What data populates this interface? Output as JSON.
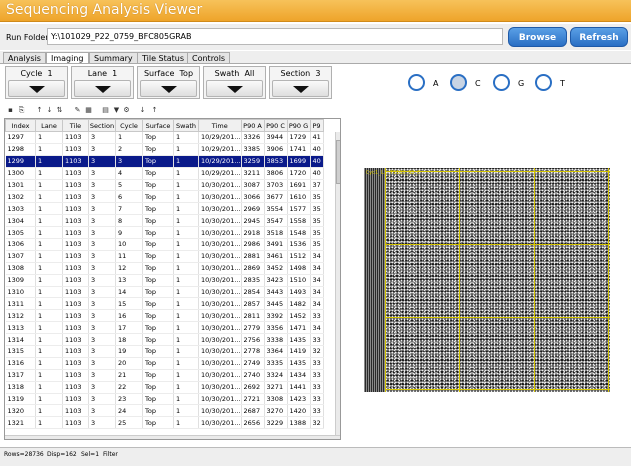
{
  "app": {
    "title": "Sequencing Analysis Viewer"
  },
  "run_folder": {
    "label": "Run Folder:",
    "value": "Y:\\101029_P22_0759_BFC805GRAB"
  },
  "buttons": {
    "browse": "Browse",
    "refresh": "Refresh"
  },
  "tabs": [
    {
      "label": "Analysis"
    },
    {
      "label": "Imaging"
    },
    {
      "label": "Summary"
    },
    {
      "label": "Tile Status"
    },
    {
      "label": "Controls"
    }
  ],
  "active_tab": "Imaging",
  "filters": [
    {
      "label": "Cycle",
      "value": "1"
    },
    {
      "label": "Lane",
      "value": "1"
    },
    {
      "label": "Surface",
      "value": "Top"
    },
    {
      "label": "Swath",
      "value": "All"
    },
    {
      "label": "Section",
      "value": "3"
    }
  ],
  "bases": [
    {
      "label": "A",
      "selected": false
    },
    {
      "label": "C",
      "selected": true
    },
    {
      "label": "G",
      "selected": false
    },
    {
      "label": "T",
      "selected": false
    }
  ],
  "toolbar_icons": [
    "save-icon",
    "copy-icon",
    "sort-ascending-icon",
    "sort-descending-icon",
    "sort-icon",
    "edit-icon",
    "grid-icon",
    "export-icon",
    "filter-icon",
    "settings-icon",
    "arrow-down-icon",
    "arrow-up-icon"
  ],
  "table": {
    "columns": [
      "Index",
      "Lane",
      "Tile",
      "Section",
      "Cycle",
      "Surface",
      "Swath",
      "Time",
      "P90 A",
      "P90 C",
      "P90 G",
      "P9"
    ],
    "selected_row": 2,
    "rows": [
      [
        "1297",
        "1",
        "1103",
        "3",
        "1",
        "Top",
        "1",
        "10/29/201...",
        "3326",
        "3944",
        "1729",
        "41"
      ],
      [
        "1298",
        "1",
        "1103",
        "3",
        "2",
        "Top",
        "1",
        "10/29/201...",
        "3385",
        "3906",
        "1741",
        "40"
      ],
      [
        "1299",
        "1",
        "1103",
        "3",
        "3",
        "Top",
        "1",
        "10/29/201...",
        "3259",
        "3853",
        "1699",
        "40"
      ],
      [
        "1300",
        "1",
        "1103",
        "3",
        "4",
        "Top",
        "1",
        "10/29/201...",
        "3211",
        "3806",
        "1720",
        "40"
      ],
      [
        "1301",
        "1",
        "1103",
        "3",
        "5",
        "Top",
        "1",
        "10/30/201...",
        "3087",
        "3703",
        "1691",
        "37"
      ],
      [
        "1302",
        "1",
        "1103",
        "3",
        "6",
        "Top",
        "1",
        "10/30/201...",
        "3066",
        "3677",
        "1610",
        "35"
      ],
      [
        "1303",
        "1",
        "1103",
        "3",
        "7",
        "Top",
        "1",
        "10/30/201...",
        "2969",
        "3554",
        "1577",
        "35"
      ],
      [
        "1304",
        "1",
        "1103",
        "3",
        "8",
        "Top",
        "1",
        "10/30/201...",
        "2945",
        "3547",
        "1558",
        "35"
      ],
      [
        "1305",
        "1",
        "1103",
        "3",
        "9",
        "Top",
        "1",
        "10/30/201...",
        "2918",
        "3518",
        "1548",
        "35"
      ],
      [
        "1306",
        "1",
        "1103",
        "3",
        "10",
        "Top",
        "1",
        "10/30/201...",
        "2986",
        "3491",
        "1536",
        "35"
      ],
      [
        "1307",
        "1",
        "1103",
        "3",
        "11",
        "Top",
        "1",
        "10/30/201...",
        "2881",
        "3461",
        "1512",
        "34"
      ],
      [
        "1308",
        "1",
        "1103",
        "3",
        "12",
        "Top",
        "1",
        "10/30/201...",
        "2869",
        "3452",
        "1498",
        "34"
      ],
      [
        "1309",
        "1",
        "1103",
        "3",
        "13",
        "Top",
        "1",
        "10/30/201...",
        "2835",
        "3423",
        "1510",
        "34"
      ],
      [
        "1310",
        "1",
        "1103",
        "3",
        "14",
        "Top",
        "1",
        "10/30/201...",
        "2854",
        "3443",
        "1493",
        "34"
      ],
      [
        "1311",
        "1",
        "1103",
        "3",
        "15",
        "Top",
        "1",
        "10/30/201...",
        "2857",
        "3445",
        "1482",
        "34"
      ],
      [
        "1312",
        "1",
        "1103",
        "3",
        "16",
        "Top",
        "1",
        "10/30/201...",
        "2811",
        "3392",
        "1452",
        "33"
      ],
      [
        "1313",
        "1",
        "1103",
        "3",
        "17",
        "Top",
        "1",
        "10/30/201...",
        "2779",
        "3356",
        "1471",
        "34"
      ],
      [
        "1314",
        "1",
        "1103",
        "3",
        "18",
        "Top",
        "1",
        "10/30/201...",
        "2756",
        "3338",
        "1435",
        "33"
      ],
      [
        "1315",
        "1",
        "1103",
        "3",
        "19",
        "Top",
        "1",
        "10/30/201...",
        "2778",
        "3364",
        "1419",
        "32"
      ],
      [
        "1316",
        "1",
        "1103",
        "3",
        "20",
        "Top",
        "1",
        "10/30/201...",
        "2749",
        "3335",
        "1435",
        "33"
      ],
      [
        "1317",
        "1",
        "1103",
        "3",
        "21",
        "Top",
        "1",
        "10/30/201...",
        "2740",
        "3324",
        "1434",
        "33"
      ],
      [
        "1318",
        "1",
        "1103",
        "3",
        "22",
        "Top",
        "1",
        "10/30/201...",
        "2692",
        "3271",
        "1441",
        "33"
      ],
      [
        "1319",
        "1",
        "1103",
        "3",
        "23",
        "Top",
        "1",
        "10/30/201...",
        "2721",
        "3308",
        "1423",
        "33"
      ],
      [
        "1320",
        "1",
        "1103",
        "3",
        "24",
        "Top",
        "1",
        "10/30/201...",
        "2687",
        "3270",
        "1420",
        "33"
      ],
      [
        "1321",
        "1",
        "1103",
        "3",
        "25",
        "Top",
        "1",
        "10/30/201...",
        "2656",
        "3229",
        "1388",
        "32"
      ]
    ]
  },
  "status": {
    "rows": "Rows=28736",
    "disp": "Disp=162",
    "sel": "Sel=1",
    "filter": "Filter"
  },
  "image": {
    "caption": "Cyc1_L1_T1103_S3_C"
  },
  "colors": {
    "accent": "#2a6fc4",
    "title_bar": "#f0a830",
    "selection": "#0a1a8a",
    "grid_lines": "#d4c400"
  }
}
